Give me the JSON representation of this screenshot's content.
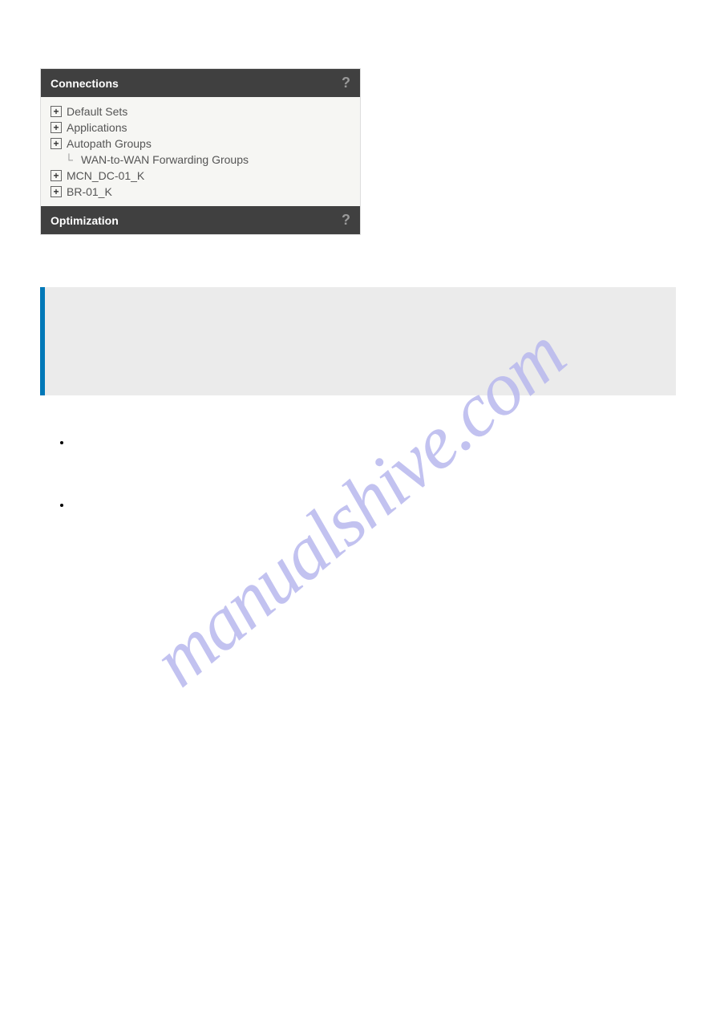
{
  "panel1": {
    "title": "Connections",
    "items": [
      {
        "label": "Default Sets",
        "expandable": true
      },
      {
        "label": "Applications",
        "expandable": true
      },
      {
        "label": "Autopath Groups",
        "expandable": true
      },
      {
        "label": "WAN-to-WAN Forwarding Groups",
        "expandable": false,
        "indented": true
      },
      {
        "label": "MCN_DC-01_K",
        "expandable": true
      },
      {
        "label": "BR-01_K",
        "expandable": true
      }
    ]
  },
  "panel2": {
    "title": "Optimization"
  },
  "help_symbol": "?",
  "expand_symbol": "+",
  "watermark": "manualshive.com"
}
